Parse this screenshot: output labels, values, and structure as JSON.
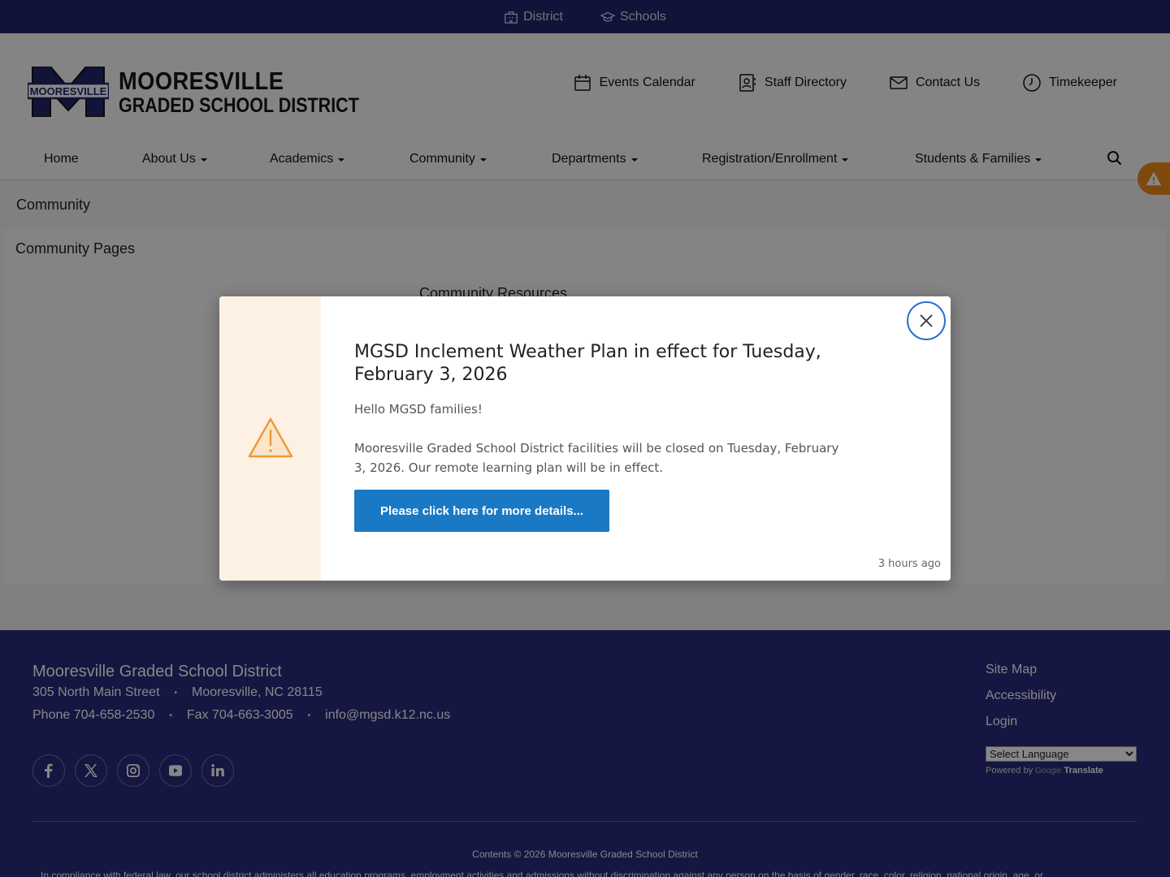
{
  "topbar": {
    "items": [
      {
        "label": "District",
        "icon": "building-icon"
      },
      {
        "label": "Schools",
        "icon": "graduation-cap-icon"
      }
    ]
  },
  "logo": {
    "mark_text": "MOORESVILLE",
    "line1": "MOORESVILLE",
    "line2": "GRADED SCHOOL DISTRICT",
    "brand_color": "#23246b"
  },
  "quick_links": [
    {
      "label": "Events Calendar",
      "icon": "calendar-icon"
    },
    {
      "label": "Staff Directory",
      "icon": "contact-card-icon"
    },
    {
      "label": "Contact Us",
      "icon": "envelope-icon"
    },
    {
      "label": "Timekeeper",
      "icon": "clock-icon"
    }
  ],
  "nav": {
    "items": [
      {
        "label": "Home",
        "dropdown": false
      },
      {
        "label": "About Us",
        "dropdown": true
      },
      {
        "label": "Academics",
        "dropdown": true
      },
      {
        "label": "Community",
        "dropdown": true
      },
      {
        "label": "Departments",
        "dropdown": true
      },
      {
        "label": "Registration/Enrollment",
        "dropdown": true
      },
      {
        "label": "Students & Families",
        "dropdown": true
      }
    ],
    "search_icon": "search-icon"
  },
  "alert_tab_icon": "warning-icon",
  "page": {
    "title": "Community",
    "section_title": "Community Pages",
    "sub_title": "Community Resources"
  },
  "modal": {
    "icon": "warning-icon",
    "title": "MGSD Inclement Weather Plan in effect for Tuesday, February 3, 2026",
    "greeting": "Hello MGSD families!",
    "body": "Mooresville Graded School District facilities will be closed on Tuesday, February 3, 2026. Our remote learning plan will be in effect.",
    "button_label": "Please click here for more details...",
    "timestamp": "3 hours ago",
    "accent_color": "#1a79c4",
    "side_color": "#fdf1e3"
  },
  "footer": {
    "name": "Mooresville Graded School District",
    "address": "305 North Main Street",
    "city": "Mooresville, NC 28115",
    "phone": "Phone 704-658-2530",
    "fax": "Fax 704-663-3005",
    "email": "info@mgsd.k12.nc.us",
    "separator": "•",
    "socials": [
      "facebook-icon",
      "x-icon",
      "instagram-icon",
      "youtube-icon",
      "linkedin-icon"
    ],
    "links": [
      "Site Map",
      "Accessibility",
      "Login"
    ],
    "language_select": "Select Language",
    "powered_by": "Powered by",
    "google": "Google",
    "translate": "Translate",
    "copyright": "Contents © 2026 Mooresville Graded School District",
    "legal": "In compliance with federal law, our school district administers all education programs, employment activities and admissions without discrimination against any person on the basis of gender, race, color, religion, national origin, age, or",
    "bg_color": "#292a7b"
  }
}
